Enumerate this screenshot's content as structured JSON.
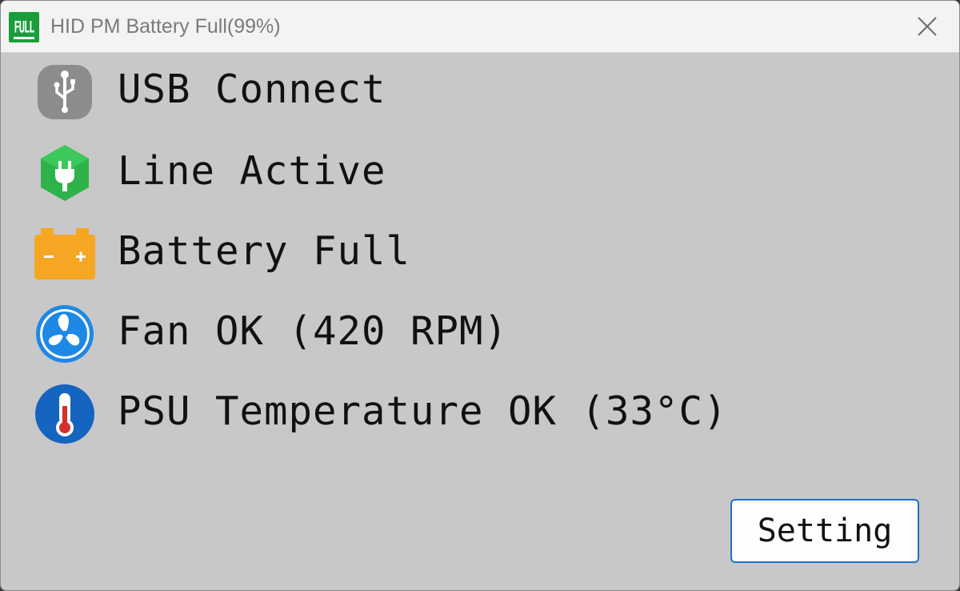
{
  "window": {
    "title": "HID PM Battery Full(99%)",
    "app_icon_text": "FULL"
  },
  "statuses": [
    {
      "label": "USB Connect",
      "icon": "usb-icon",
      "color": "#8c8c8c"
    },
    {
      "label": "Line Active",
      "icon": "plug-icon",
      "color": "#2db34a"
    },
    {
      "label": "Battery Full",
      "icon": "battery-icon",
      "color": "#f5a623"
    },
    {
      "label": "Fan OK (420 RPM)",
      "icon": "fan-icon",
      "color": "#1e88e5"
    },
    {
      "label": "PSU Temperature OK (33°C)",
      "icon": "thermometer-icon",
      "color": "#1565c0"
    }
  ],
  "buttons": {
    "setting_label": "Setting"
  },
  "colors": {
    "background": "#c8c8c8",
    "titlebar": "#f3f3f3",
    "button_border": "#1e6fcf"
  }
}
